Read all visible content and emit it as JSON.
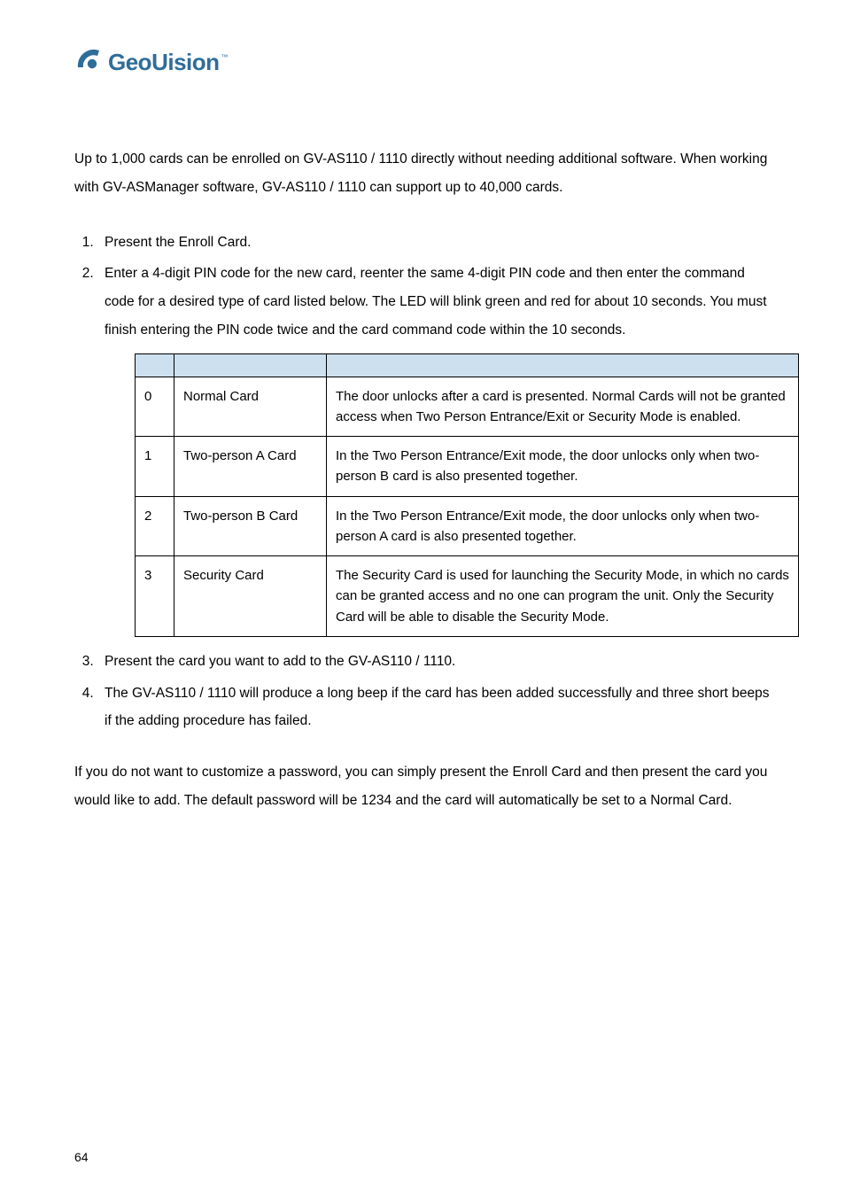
{
  "logo": {
    "brand": "GeoUision",
    "tm": "™"
  },
  "intro": "Up to 1,000 cards can be enrolled on GV-AS110 / 1110 directly without needing additional software. When working with GV-ASManager software, GV-AS110 / 1110 can support up to 40,000 cards.",
  "steps12": [
    "Present the Enroll Card.",
    "Enter a 4-digit PIN code for the new card, reenter the same 4-digit PIN code and then enter the command code for a desired type of card listed below. The LED will blink green and red for about 10 seconds. You must finish entering the PIN code twice and the card command code within the 10 seconds."
  ],
  "table": {
    "rows": [
      {
        "code": "0",
        "type": "Normal Card",
        "desc": "The door unlocks after a card is presented. Normal Cards will not be granted access when Two Person Entrance/Exit or Security Mode is enabled."
      },
      {
        "code": "1",
        "type": "Two-person A Card",
        "desc": "In the Two Person Entrance/Exit mode, the door unlocks only when two-person B card is also presented together."
      },
      {
        "code": "2",
        "type": "Two-person B Card",
        "desc": "In the Two Person Entrance/Exit mode, the door unlocks only when two-person A card is also presented together."
      },
      {
        "code": "3",
        "type": "Security Card",
        "desc": "The Security Card is used for launching the Security Mode, in which no cards can be granted access and no one can program the unit. Only the Security Card will be able to disable the Security Mode."
      }
    ]
  },
  "steps34": [
    "Present the card you want to add to the GV-AS110 / 1110.",
    "The GV-AS110 / 1110 will produce a long beep if the card has been added successfully and three short beeps if the adding procedure has failed."
  ],
  "closing": "If you do not want to customize a password, you can simply present the Enroll Card and then present the card you would like to add. The default password will be 1234 and the card will automatically be set to a Normal Card.",
  "page_number": "64"
}
